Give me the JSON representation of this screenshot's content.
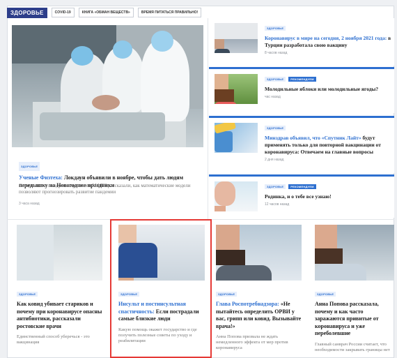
{
  "section": "ЗДОРОВЬЕ",
  "nav_tags": [
    "COVID-19",
    "КНИГА «ОБМАН ВЕЩЕСТВ»",
    "ВРЕМЯ ПИТАТЬСЯ ПРАВИЛЬНО!"
  ],
  "lead": {
    "tag": "ЗДОРОВЬЕ",
    "title_link": "Ученые Физтеха:",
    "title_rest": " Локдаун объявили в ноябре, чтобы дать людям передышку на Новогодние праздники",
    "summary": "Специалисты по здравоохранению МФТИ рассказали, как математические модели позволяют прогнозировать развитие пандемии",
    "time": "3 часа назад"
  },
  "side": [
    {
      "tags": [
        "ЗДОРОВЬЕ"
      ],
      "title_link": "Коронавирус в мире на сегодня, 2 ноября 2021 года:",
      "title_rest": " в Турции разработала свою вакцину",
      "time": "8 часов назад"
    },
    {
      "tags": [
        "ЗДОРОВЬЕ",
        "РЕКОМЕНДУЕМ"
      ],
      "title_link": "",
      "title_rest": "Молодильные яблоки или молодильные ягоды?",
      "time": "час назад"
    },
    {
      "tags": [
        "ЗДОРОВЬЕ"
      ],
      "title_link": "Минздрав объявил, что «Спутник Лайт»",
      "title_rest": " будут применять только для повторной вакцинации от коронавируса: Отвечаем на главные вопросы",
      "time": "2 дня назад"
    },
    {
      "tags": [
        "ЗДОРОВЬЕ",
        "РЕКОМЕНДУЕМ"
      ],
      "title_link": "",
      "title_rest": "Родинка, и о тебе все узнаю!",
      "time": "12 часов назад"
    }
  ],
  "cards": [
    {
      "tag": "ЗДОРОВЬЕ",
      "title_link": "",
      "title_rest": "Как ковид убивает стариков и почему при коронавирусе опасны антибиотики, рассказали ростовские врачи",
      "summary": "Единственный способ уберечься - это вакцинация"
    },
    {
      "tag": "ЗДОРОВЬЕ",
      "title_link": "Инсульт и постинсультная спастичность:",
      "title_rest": " Если пострадали самые близкие люди",
      "summary": "Какую помощь окажет государство и где получить полезные советы по уходу и реабилитации"
    },
    {
      "tag": "ЗДОРОВЬЕ",
      "title_link": "Глава Роспотребнадзора:",
      "title_rest": " «Не пытайтесь определить ОРВИ у вас, грипп или ковид. Вызывайте врача!»",
      "summary": "Анна Попова призвала не ждать немедленного эффекта от мер против коронавируса"
    },
    {
      "tag": "ЗДОРОВЬЕ",
      "title_link": "",
      "title_rest": "Анна Попова рассказала, почему и как часто заражаются привитые от коронавируса и уже переболевшие",
      "summary": "Главный санврач России считает, что необходимости закрывать границы нет"
    }
  ],
  "colors": {
    "brand": "#2d3e8a",
    "accent": "#2d6fd0",
    "highlight": "#e53935"
  }
}
